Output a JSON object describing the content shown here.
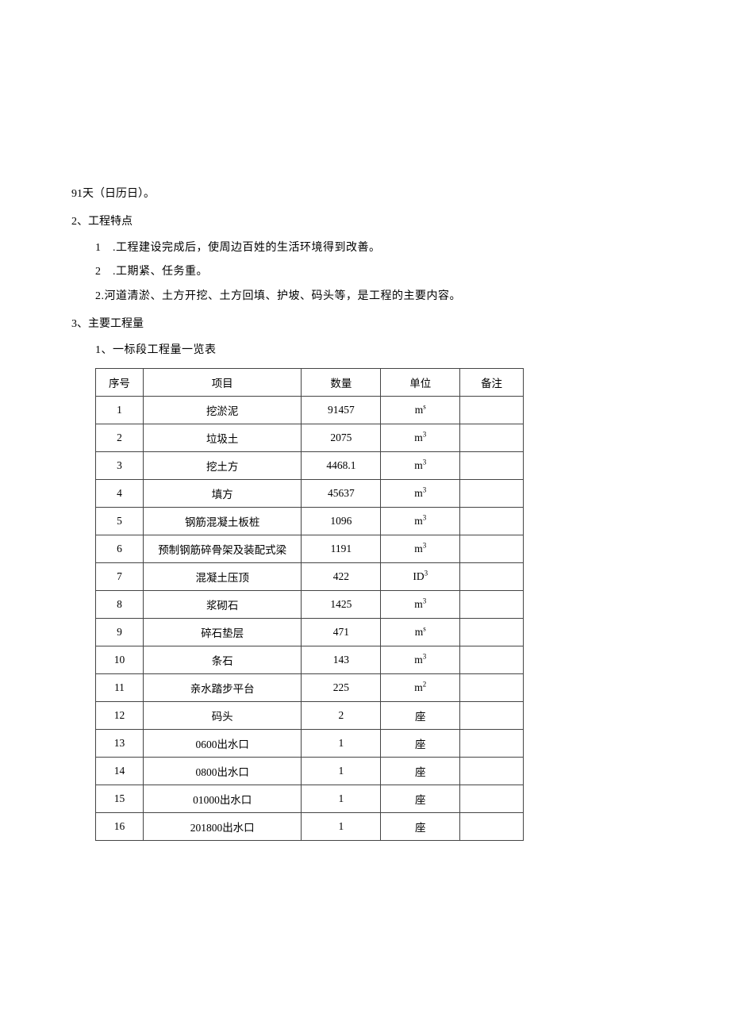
{
  "intro_line": "91天（日历日）。",
  "section2": {
    "heading": "2、工程特点",
    "items": [
      {
        "label": "1",
        "suffix": " .",
        "text": "工程建设完成后，使周边百姓的生活环境得到改善。"
      },
      {
        "label": "2",
        "suffix": " .",
        "text": "工期紧、任务重。"
      },
      {
        "label": "2.",
        "suffix": "",
        "text": "河道清淤、土方开挖、土方回填、护坡、码头等，是工程的主要内容。"
      }
    ]
  },
  "section3": {
    "heading": "3、主要工程量",
    "subheading": "1、一标段工程量一览表",
    "headers": {
      "seq": "序号",
      "item": "项目",
      "qty": "数量",
      "unit": "单位",
      "remark": "备注"
    },
    "rows": [
      {
        "seq": "1",
        "item": "挖淤泥",
        "qty": "91457",
        "unit_base": "m",
        "unit_sup": "s",
        "remark": ""
      },
      {
        "seq": "2",
        "item": "垃圾土",
        "qty": "2075",
        "unit_base": "m",
        "unit_sup": "3",
        "remark": ""
      },
      {
        "seq": "3",
        "item": "挖土方",
        "qty": "4468.1",
        "unit_base": "m",
        "unit_sup": "3",
        "remark": ""
      },
      {
        "seq": "4",
        "item": "填方",
        "qty": "45637",
        "unit_base": "m",
        "unit_sup": "3",
        "remark": ""
      },
      {
        "seq": "5",
        "item": "钢筋混凝土板桩",
        "qty": "1096",
        "unit_base": "m",
        "unit_sup": "3",
        "remark": ""
      },
      {
        "seq": "6",
        "item": "预制钢筋碎骨架及装配式梁",
        "qty": "1191",
        "unit_base": "m",
        "unit_sup": "3",
        "remark": ""
      },
      {
        "seq": "7",
        "item": "混凝土压顶",
        "qty": "422",
        "unit_base": "ID",
        "unit_sup": "3",
        "remark": ""
      },
      {
        "seq": "8",
        "item": "浆砌石",
        "qty": "1425",
        "unit_base": "m",
        "unit_sup": "3",
        "remark": ""
      },
      {
        "seq": "9",
        "item": "碎石垫层",
        "qty": "471",
        "unit_base": "m",
        "unit_sup": "s",
        "remark": ""
      },
      {
        "seq": "10",
        "item": "条石",
        "qty": "143",
        "unit_base": "m",
        "unit_sup": "3",
        "remark": ""
      },
      {
        "seq": "11",
        "item": "亲水踏步平台",
        "qty": "225",
        "unit_base": "m",
        "unit_sup": "2",
        "remark": ""
      },
      {
        "seq": "12",
        "item": "码头",
        "qty": "2",
        "unit_base": "座",
        "unit_sup": "",
        "remark": ""
      },
      {
        "seq": "13",
        "item": "0600出水口",
        "qty": "1",
        "unit_base": "座",
        "unit_sup": "",
        "remark": ""
      },
      {
        "seq": "14",
        "item": "0800出水口",
        "qty": "1",
        "unit_base": "座",
        "unit_sup": "",
        "remark": ""
      },
      {
        "seq": "15",
        "item": "01000出水口",
        "qty": "1",
        "unit_base": "座",
        "unit_sup": "",
        "remark": ""
      },
      {
        "seq": "16",
        "item": "201800出水口",
        "qty": "1",
        "unit_base": "座",
        "unit_sup": "",
        "remark": ""
      }
    ]
  },
  "chart_data": {
    "type": "table",
    "title": "一标段工程量一览表",
    "columns": [
      "序号",
      "项目",
      "数量",
      "单位",
      "备注"
    ],
    "rows": [
      [
        "1",
        "挖淤泥",
        "91457",
        "m^s",
        ""
      ],
      [
        "2",
        "垃圾土",
        "2075",
        "m^3",
        ""
      ],
      [
        "3",
        "挖土方",
        "4468.1",
        "m^3",
        ""
      ],
      [
        "4",
        "填方",
        "45637",
        "m^3",
        ""
      ],
      [
        "5",
        "钢筋混凝土板桩",
        "1096",
        "m^3",
        ""
      ],
      [
        "6",
        "预制钢筋碎骨架及装配式梁",
        "1191",
        "m^3",
        ""
      ],
      [
        "7",
        "混凝土压顶",
        "422",
        "ID^3",
        ""
      ],
      [
        "8",
        "浆砌石",
        "1425",
        "m^3",
        ""
      ],
      [
        "9",
        "碎石垫层",
        "471",
        "m^s",
        ""
      ],
      [
        "10",
        "条石",
        "143",
        "m^3",
        ""
      ],
      [
        "11",
        "亲水踏步平台",
        "225",
        "m^2",
        ""
      ],
      [
        "12",
        "码头",
        "2",
        "座",
        ""
      ],
      [
        "13",
        "0600出水口",
        "1",
        "座",
        ""
      ],
      [
        "14",
        "0800出水口",
        "1",
        "座",
        ""
      ],
      [
        "15",
        "01000出水口",
        "1",
        "座",
        ""
      ],
      [
        "16",
        "201800出水口",
        "1",
        "座",
        ""
      ]
    ]
  }
}
